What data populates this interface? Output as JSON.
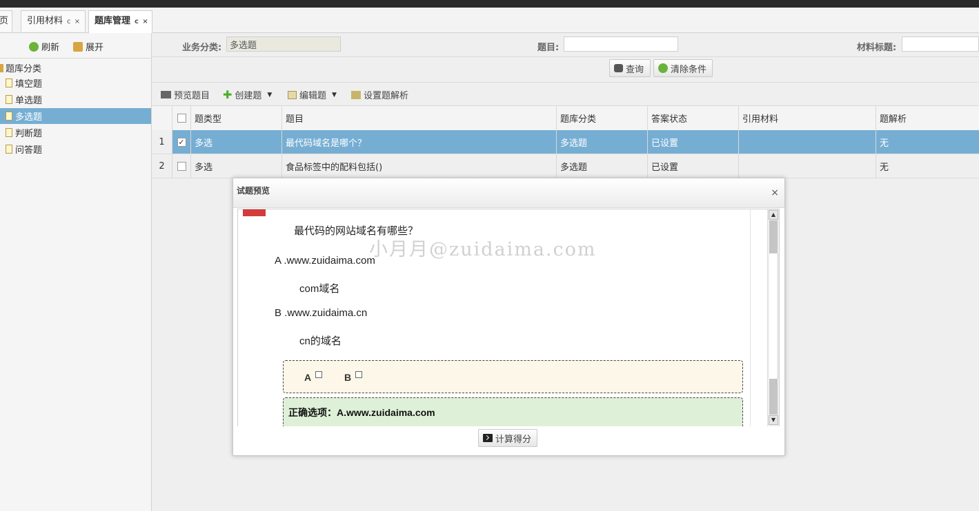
{
  "tabs": [
    {
      "label": "页",
      "closable": false
    },
    {
      "label": "引用材料",
      "closable": true
    },
    {
      "label": "题库管理",
      "closable": true
    }
  ],
  "tab_controls": "c ×",
  "sidebar": {
    "refresh_label": "刷新",
    "expand_label": "展开",
    "root_label": "题库分类",
    "items": [
      {
        "label": "填空题"
      },
      {
        "label": "单选题"
      },
      {
        "label": "多选题"
      },
      {
        "label": "判断题"
      },
      {
        "label": "问答题"
      }
    ],
    "selected_index": 2
  },
  "search": {
    "category_label": "业务分类:",
    "category_value": "多选题",
    "title_label": "题目:",
    "title_value": "",
    "material_label": "材料标题:",
    "material_value": "",
    "query_label": "查询",
    "clear_label": "清除条件"
  },
  "toolbar": {
    "preview_label": "预览题目",
    "create_label": "创建题",
    "edit_label": "编辑题",
    "analysis_label": "设置题解析"
  },
  "grid": {
    "columns": [
      "题类型",
      "题目",
      "题库分类",
      "答案状态",
      "引用材料",
      "题解析"
    ],
    "rows": [
      {
        "num": "1",
        "checked": true,
        "type": "多选",
        "title": "最代码域名是哪个？",
        "category": "多选题",
        "status": "已设置",
        "material": "",
        "analysis": "无"
      },
      {
        "num": "2",
        "checked": false,
        "type": "多选",
        "title": "食品标签中的配料包括()",
        "category": "多选题",
        "status": "已设置",
        "material": "",
        "analysis": "无"
      }
    ]
  },
  "dialog": {
    "title": "试题预览",
    "close": "×",
    "question": "最代码的网站域名有哪些？",
    "watermark": "小月月@zuidaima.com",
    "options": [
      {
        "key": "A",
        "text": ".www.zuidaima.com",
        "desc": "com域名"
      },
      {
        "key": "B",
        "text": ".www.zuidaima.cn",
        "desc": "cn的域名"
      }
    ],
    "answer_choices": [
      "A",
      "B"
    ],
    "correct_label": "正确选项：A.www.zuidaima.com",
    "compute_label": "计算得分"
  },
  "colors": {
    "selected_row": "#76aed3",
    "answer_box": "#fcf7e8",
    "correct_box": "#dff0d8",
    "mark": "#d43b3b"
  }
}
